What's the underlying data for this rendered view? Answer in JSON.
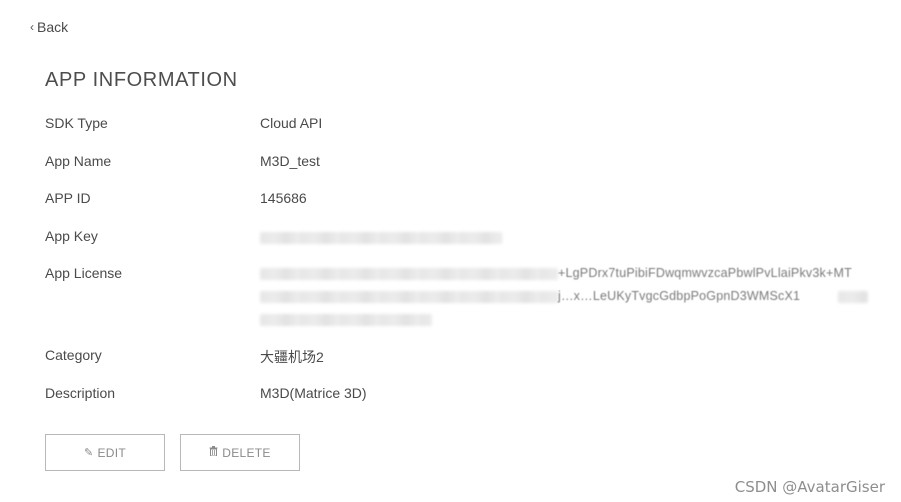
{
  "nav": {
    "back_label": "Back"
  },
  "page": {
    "title": "APP INFORMATION"
  },
  "fields": {
    "sdk_type": {
      "label": "SDK Type",
      "value": "Cloud API"
    },
    "app_name": {
      "label": "App Name",
      "value": "M3D_test"
    },
    "app_id": {
      "label": "APP ID",
      "value": "145686"
    },
    "app_key": {
      "label": "App Key",
      "value": ""
    },
    "app_license": {
      "label": "App License",
      "line1_visible": "+LgPDrx7tuPibiFDwqmwvzcaPbwlPvLlaiPkv3k+MT",
      "line2_visible": "j…x…LeUKyTvgcGdbpPoGpnD3WMScX1"
    },
    "category": {
      "label": "Category",
      "value": "大疆机场2"
    },
    "description": {
      "label": "Description",
      "value": "M3D(Matrice 3D)"
    }
  },
  "actions": {
    "edit_label": "EDIT",
    "delete_label": "DELETE"
  },
  "icons": {
    "edit": "pencil-icon",
    "delete": "trash-icon",
    "back": "chevron-left-icon"
  },
  "watermark": "CSDN @AvatarGiser"
}
